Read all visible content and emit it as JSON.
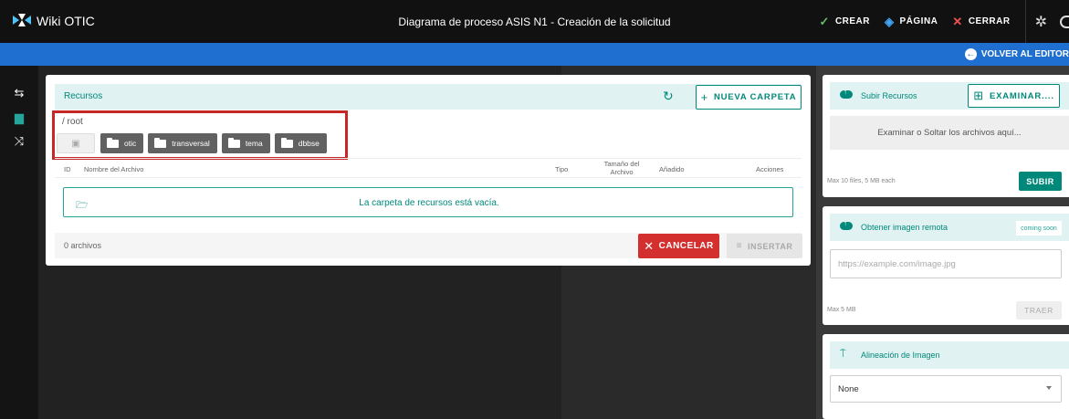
{
  "app": {
    "brand": "Wiki OTIC",
    "doc_title": "Diagrama de proceso ASIS N1 - Creación de la solicitud"
  },
  "topbar": {
    "crear": "CREAR",
    "pagina": "PÁGINA",
    "cerrar": "CERRAR"
  },
  "bluebar": {
    "back_label": "VOLVER AL EDITOR"
  },
  "leftbar": {
    "items": [
      "link-icon",
      "folder-icon",
      "collapse-icon"
    ],
    "active": "folder-icon"
  },
  "resources": {
    "header": "Recursos",
    "new_folder": "NUEVA CARPETA",
    "path": "/ root",
    "folders": [
      "otic",
      "transversal",
      "tema",
      "dbbse"
    ],
    "columns": {
      "id": "ID",
      "name": "Nombre del Archivo",
      "type": "Tipo",
      "size": "Tamaño del Archivo",
      "added": "Añadido",
      "actions": "Acciones"
    },
    "empty_message": "La carpeta de recursos está vacía.",
    "count": "0 archivos",
    "cancel": "CANCELAR",
    "insert": "INSERTAR"
  },
  "upload": {
    "header": "Subir Recursos",
    "browse": "EXAMINAR....",
    "dropzone": "Examinar o Soltar los archivos aquí...",
    "note": "Max 10 files, 5 MB each",
    "submit": "SUBIR"
  },
  "remote": {
    "header": "Obtener imagen remota",
    "badge": "coming soon",
    "placeholder": "https://example.com/image.jpg",
    "note": "Max 5 MB",
    "fetch": "TRAER"
  },
  "alignment": {
    "header": "Alineación de Imagen",
    "value": "None"
  },
  "colors": {
    "teal": "#00897b",
    "teal_light": "#e0f2f1",
    "blue": "#1e6fd0",
    "red": "#d32f2f",
    "highlight": "#c62828"
  }
}
